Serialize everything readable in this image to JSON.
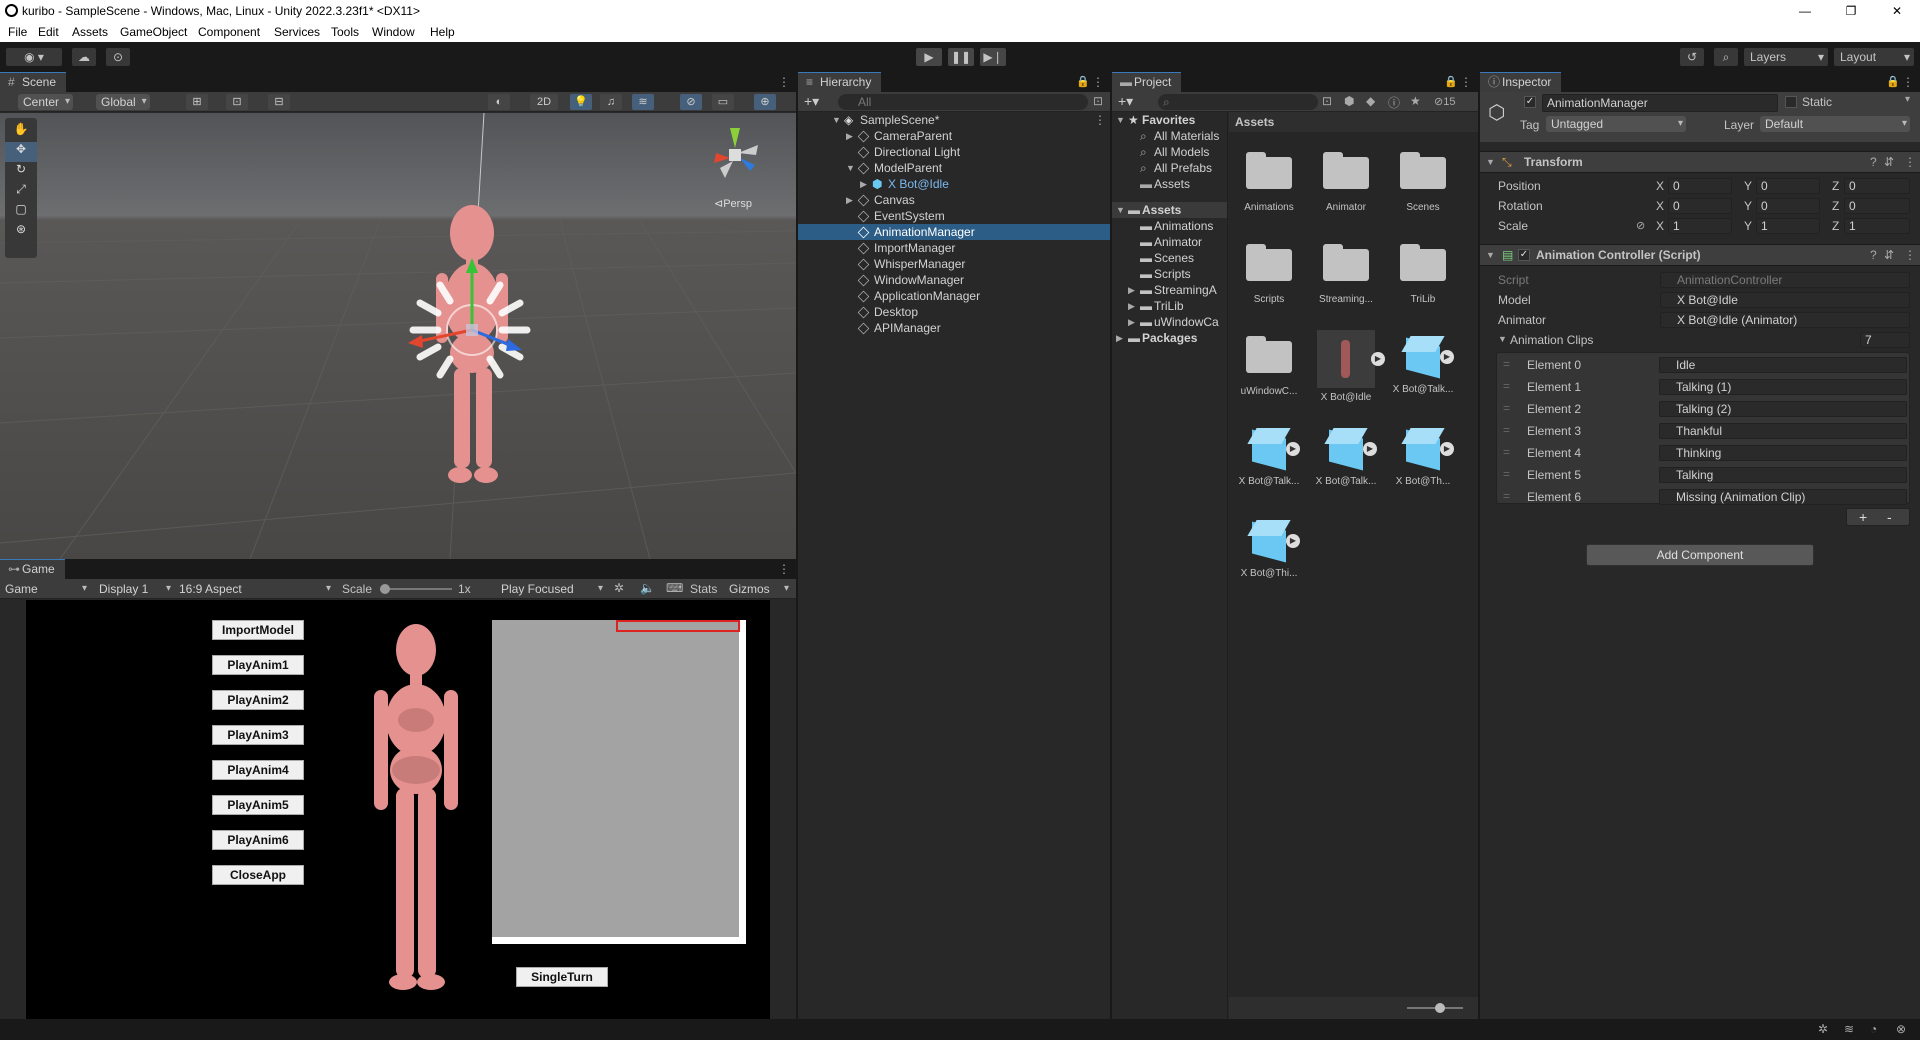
{
  "window": {
    "title": "kuribo - SampleScene - Windows, Mac, Linux - Unity 2022.3.23f1* <DX11>",
    "minimize": "—",
    "restore": "❐",
    "close": "✕"
  },
  "menu": [
    "File",
    "Edit",
    "Assets",
    "GameObject",
    "Component",
    "Services",
    "Tools",
    "Window",
    "Help"
  ],
  "toolbar": {
    "play_icon": "play-icon",
    "pause_icon": "pause-icon",
    "step_icon": "step-icon",
    "layers": "Layers",
    "layout": "Layout"
  },
  "scene": {
    "tab": "Scene",
    "pivot": "Center",
    "space": "Global",
    "mode2d": "2D",
    "persp": "⊲Persp"
  },
  "game": {
    "tab": "Game",
    "view": "Game",
    "display": "Display 1",
    "aspect": "16:9 Aspect",
    "scale_label": "Scale",
    "scale_value": "1x",
    "play_mode": "Play Focused",
    "stats": "Stats",
    "gizmos": "Gizmos",
    "buttons": [
      "ImportModel",
      "PlayAnim1",
      "PlayAnim2",
      "PlayAnim3",
      "PlayAnim4",
      "PlayAnim5",
      "PlayAnim6",
      "CloseApp"
    ],
    "single_turn": "SingleTurn"
  },
  "hierarchy": {
    "tab": "Hierarchy",
    "search_placeholder": "All",
    "scene_name": "SampleScene*",
    "items": [
      "CameraParent",
      "Directional Light",
      "ModelParent",
      "X Bot@Idle",
      "Canvas",
      "EventSystem",
      "AnimationManager",
      "ImportManager",
      "WhisperManager",
      "WindowManager",
      "ApplicationManager",
      "Desktop",
      "APIManager"
    ]
  },
  "project": {
    "tab": "Project",
    "hidden_count": "15",
    "favorites_label": "Favorites",
    "favorites": [
      "All Materials",
      "All Models",
      "All Prefabs",
      "Assets"
    ],
    "assets_label": "Assets",
    "assets_tree": [
      "Animations",
      "Animator",
      "Scenes",
      "Scripts",
      "StreamingA",
      "TriLib",
      "uWindowCa"
    ],
    "packages_label": "Packages",
    "breadcrumb": "Assets",
    "grid": [
      {
        "name": "Animations",
        "kind": "folder"
      },
      {
        "name": "Animator",
        "kind": "folder"
      },
      {
        "name": "Scenes",
        "kind": "folder"
      },
      {
        "name": "Scripts",
        "kind": "folder"
      },
      {
        "name": "Streaming...",
        "kind": "folder"
      },
      {
        "name": "TriLib",
        "kind": "folder"
      },
      {
        "name": "uWindowC...",
        "kind": "folder"
      },
      {
        "name": "X Bot@Idle",
        "kind": "model"
      },
      {
        "name": "X Bot@Talk...",
        "kind": "prefab"
      },
      {
        "name": "X Bot@Talk...",
        "kind": "prefab"
      },
      {
        "name": "X Bot@Talk...",
        "kind": "prefab"
      },
      {
        "name": "X Bot@Th...",
        "kind": "prefab"
      },
      {
        "name": "X Bot@Thi...",
        "kind": "prefab"
      }
    ]
  },
  "inspector": {
    "tab": "Inspector",
    "object_name": "AnimationManager",
    "static_label": "Static",
    "tag_label": "Tag",
    "tag_value": "Untagged",
    "layer_label": "Layer",
    "layer_value": "Default",
    "transform": {
      "title": "Transform",
      "rows": [
        {
          "label": "Position",
          "x": "0",
          "y": "0",
          "z": "0"
        },
        {
          "label": "Rotation",
          "x": "0",
          "y": "0",
          "z": "0"
        },
        {
          "label": "Scale",
          "x": "1",
          "y": "1",
          "z": "1"
        }
      ]
    },
    "script_comp": {
      "title": "Animation Controller (Script)",
      "script_label": "Script",
      "script_value": "AnimationController",
      "model_label": "Model",
      "model_value": "X Bot@Idle",
      "animator_label": "Animator",
      "animator_value": "X Bot@Idle (Animator)",
      "clips_label": "Animation Clips",
      "clips_count": "7",
      "clips": [
        {
          "label": "Element 0",
          "value": "Idle"
        },
        {
          "label": "Element 1",
          "value": "Talking (1)"
        },
        {
          "label": "Element 2",
          "value": "Talking (2)"
        },
        {
          "label": "Element 3",
          "value": "Thankful"
        },
        {
          "label": "Element 4",
          "value": "Thinking"
        },
        {
          "label": "Element 5",
          "value": "Talking"
        },
        {
          "label": "Element 6",
          "value": "Missing (Animation Clip)"
        }
      ]
    },
    "add_component": "Add Component"
  },
  "colors": {
    "accent": "#3a79bb",
    "selection": "#2c5d87",
    "model": "#e4918f"
  }
}
